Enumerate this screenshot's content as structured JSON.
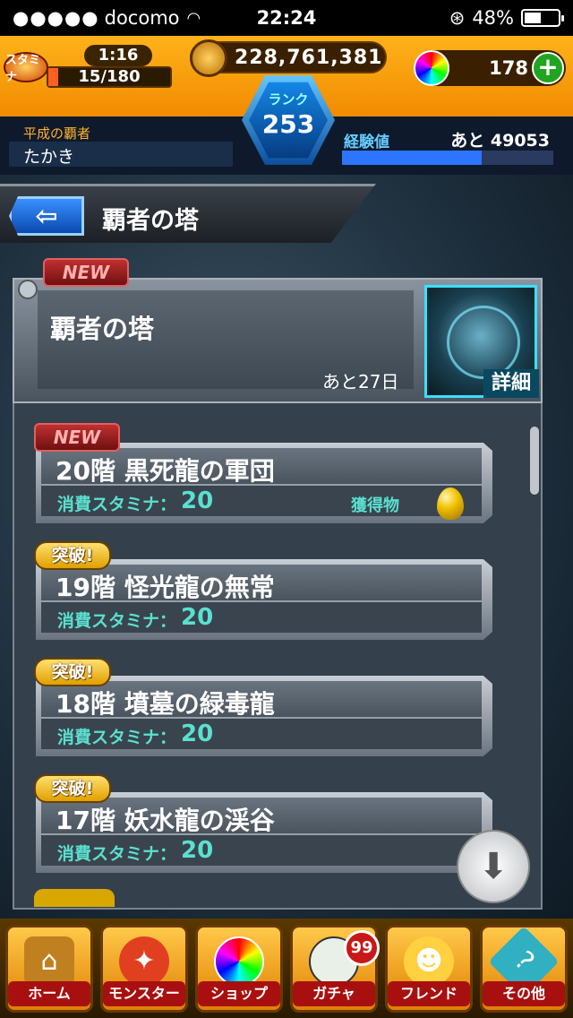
{
  "status_bar": {
    "signal": "●●●●●",
    "carrier": "docomo",
    "time": "22:24",
    "battery": "48%"
  },
  "header": {
    "stamina_label": "スタミナ",
    "stamina_timer": "1:16",
    "stamina_value": "15/180",
    "stamina_fraction": 0.083,
    "coins": "228,761,381",
    "orbs": "178",
    "rank_label": "ランク",
    "rank_value": "253",
    "player_title": "平成の覇者",
    "player_name": "たかき",
    "exp_label": "経験値",
    "exp_remaining": "あと 49053",
    "exp_fraction": 0.66
  },
  "page": {
    "title": "覇者の塔"
  },
  "event": {
    "new_label": "NEW",
    "name": "覇者の塔",
    "remaining": "あと27日",
    "detail_label": "詳細"
  },
  "floors": [
    {
      "badge": "NEW",
      "name": "20階 黒死龍の軍団",
      "cost_label": "消費スタミナ：",
      "cost": "20",
      "reward_label": "獲得物"
    },
    {
      "badge": "突破!",
      "name": "19階 怪光龍の無常",
      "cost_label": "消費スタミナ：",
      "cost": "20"
    },
    {
      "badge": "突破!",
      "name": "18階 墳墓の緑毒龍",
      "cost_label": "消費スタミナ：",
      "cost": "20"
    },
    {
      "badge": "突破!",
      "name": "17階 妖水龍の渓谷",
      "cost_label": "消費スタミナ：",
      "cost": "20"
    }
  ],
  "nav": {
    "home": "ホーム",
    "monster": "モンスター",
    "shop": "ショップ",
    "gacha": "ガチャ",
    "gacha_count": "99",
    "friend": "フレンド",
    "other": "その他"
  },
  "colors": {
    "header_orange": "#f08a00",
    "accent_cyan": "#5ae0d0",
    "back_blue": "#0a4ab0"
  }
}
